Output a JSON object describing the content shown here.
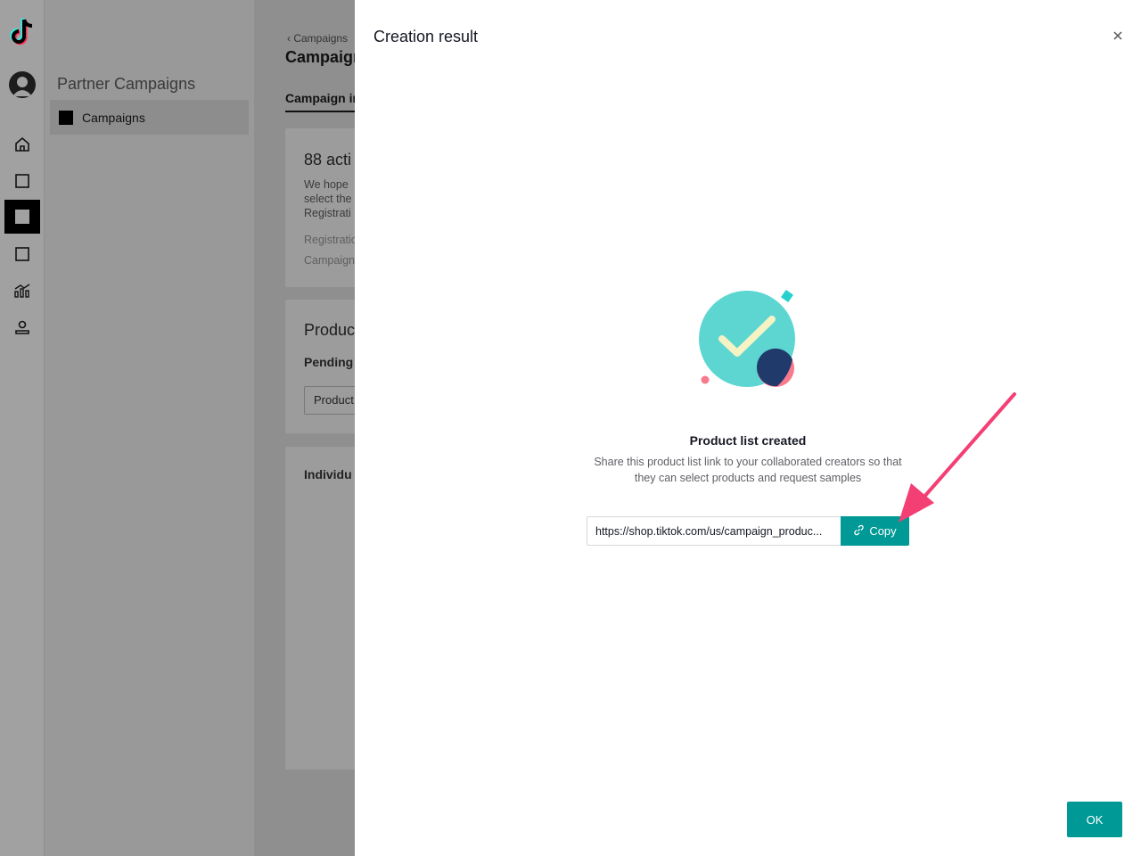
{
  "sidebar": {
    "icons": [
      "tiktok-logo-icon",
      "avatar",
      "home-icon",
      "square-icon",
      "campaigns-icon",
      "square-icon",
      "analytics-icon",
      "account-icon"
    ]
  },
  "subnav": {
    "title": "Partner Campaigns",
    "items": [
      {
        "label": "Campaigns",
        "active": true
      }
    ]
  },
  "main": {
    "breadcrumb": "Campaigns",
    "page_title": "Campaign",
    "tab_label": "Campaign in",
    "card1": {
      "heading": "88 acti",
      "lines": [
        "We hope",
        "select the",
        "Registrati"
      ],
      "meta": [
        "Registratio",
        "Campaign"
      ]
    },
    "card2": {
      "heading": "Produc",
      "subheading": "Pending",
      "field": "Product"
    },
    "card3": {
      "heading": "Individu"
    }
  },
  "drawer": {
    "title": "Creation result",
    "result_title": "Product list created",
    "result_desc": "Share this product list link to your collaborated creators so that they can select products and request samples",
    "link_value": "https://shop.tiktok.com/us/campaign_produc...",
    "copy_label": "Copy",
    "ok_label": "OK"
  },
  "colors": {
    "accent": "#009995",
    "annotation_arrow": "#f43f74",
    "illustration_teal": "#5dd6d2",
    "illustration_navy": "#1f3a6b",
    "illustration_pink": "#f87a8c"
  }
}
